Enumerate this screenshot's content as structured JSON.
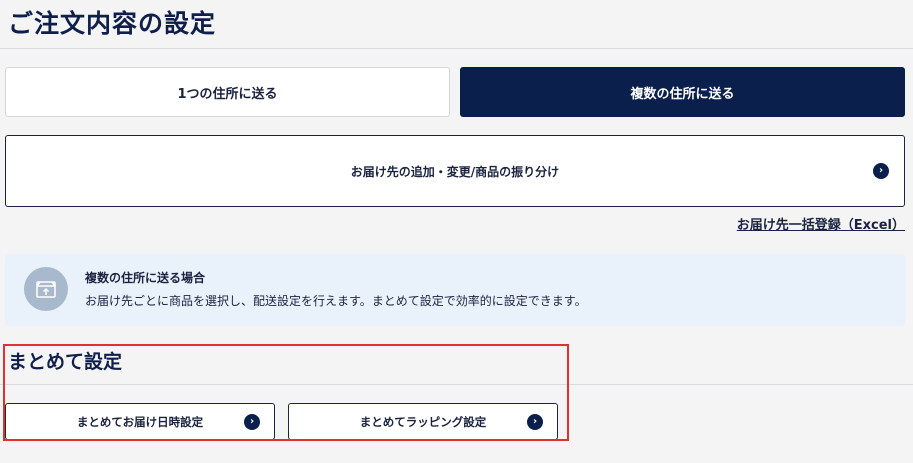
{
  "page": {
    "title": "ご注文内容の設定"
  },
  "tabs": [
    {
      "label": "1つの住所に送る",
      "selected": false
    },
    {
      "label": "複数の住所に送る",
      "selected": true
    }
  ],
  "assign_box": {
    "label": "お届け先の追加・変更/商品の振り分け",
    "icon": "chevron-right-icon"
  },
  "excel_link": {
    "label": "お届け先一括登録（Excel）"
  },
  "info": {
    "icon": "package-icon",
    "title": "複数の住所に送る場合",
    "description": "お届け先ごとに商品を選択し、配送設定を行えます。まとめて設定で効率的に設定できます。"
  },
  "bulk_section": {
    "title": "まとめて設定",
    "buttons": [
      {
        "label": "まとめてお届け日時設定",
        "icon": "chevron-right-icon"
      },
      {
        "label": "まとめてラッピング設定",
        "icon": "chevron-right-icon"
      }
    ]
  },
  "colors": {
    "navy": "#0b1f4d",
    "info_bg": "#e9f1fb",
    "highlight": "#e0322c"
  }
}
